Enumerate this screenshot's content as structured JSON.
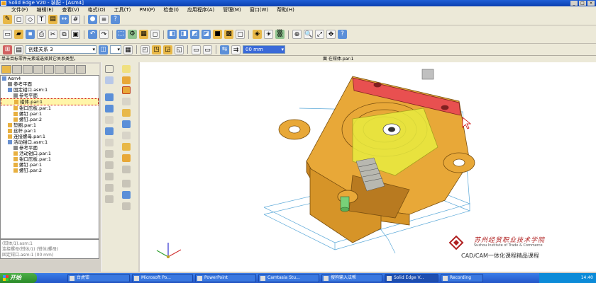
{
  "title": {
    "text": "Solid Edge V20 - 装配 - [Asm4]"
  },
  "window_buttons": [
    "_",
    "□",
    "×"
  ],
  "menu": [
    "文件(F)",
    "编辑(E)",
    "查看(V)",
    "格式(O)",
    "工具(T)",
    "PMI(P)",
    "检查(I)",
    "应用程序(A)",
    "管理(M)",
    "窗口(W)",
    "帮助(H)"
  ],
  "ribbon": {
    "relation_type": "创建关系 3",
    "offset_value": "00 mm"
  },
  "prompt": {
    "left": "单击目标零件元素或选择其它关系类型。",
    "right": "面 在钳体.par:1"
  },
  "tree": [
    {
      "label": "Asm4",
      "indent": 0,
      "icon": "assembly-icon"
    },
    {
      "label": "参考平面",
      "indent": 1,
      "icon": "plane-icon"
    },
    {
      "label": "固定钳口.asm:1",
      "indent": 1,
      "icon": "assembly-icon"
    },
    {
      "label": "参考平面",
      "indent": 2,
      "icon": "plane-icon"
    },
    {
      "label": "钳体.par:1",
      "indent": 2,
      "icon": "part-icon",
      "highlight": true
    },
    {
      "label": "钳口压板.par:1",
      "indent": 2,
      "icon": "part-icon"
    },
    {
      "label": "螺钉.par:1",
      "indent": 2,
      "icon": "part-icon"
    },
    {
      "label": "螺钉.par:2",
      "indent": 2,
      "icon": "part-icon"
    },
    {
      "label": "垫圈.par:1",
      "indent": 1,
      "icon": "part-icon"
    },
    {
      "label": "丝杆.par:1",
      "indent": 1,
      "icon": "part-icon"
    },
    {
      "label": "连接螺母.par:1",
      "indent": 1,
      "icon": "part-icon"
    },
    {
      "label": "活动钳口.asm:1",
      "indent": 1,
      "icon": "assembly-icon"
    },
    {
      "label": "参考平面",
      "indent": 2,
      "icon": "plane-icon"
    },
    {
      "label": "活动钳口.par:1",
      "indent": 2,
      "icon": "part-icon"
    },
    {
      "label": "钳口压板.par:1",
      "indent": 2,
      "icon": "part-icon"
    },
    {
      "label": "螺钉.par:1",
      "indent": 2,
      "icon": "part-icon"
    },
    {
      "label": "螺钉.par:2",
      "indent": 2,
      "icon": "part-icon"
    }
  ],
  "tree_bottom": [
    "(钳体/1).asm:1",
    "连接螺母(钳体/1)  (钳体/螺母)",
    "固定钳口.asm:1   (00 mm)"
  ],
  "logo": {
    "name_cn": "苏州经贸职业技术学院",
    "name_en": "Suzhou Institute of Trade & Commerce",
    "course": "CAD/CAM一体化课程精品课程"
  },
  "taskbar": {
    "start": "开始",
    "tasks": [
      "台虎钳",
      "Microsoft Po...",
      "PowerPoint",
      "Camtasia Stu...",
      "搜狗输入法帮",
      "Solid Edge V...",
      "Recording"
    ],
    "active_index": 5,
    "clock": "14:40"
  },
  "colors": {
    "part_body": "#e8a838",
    "highlight_face": "#e85050",
    "selection_yellow": "#e8ec40",
    "title_blue": "#0a3fb0"
  }
}
